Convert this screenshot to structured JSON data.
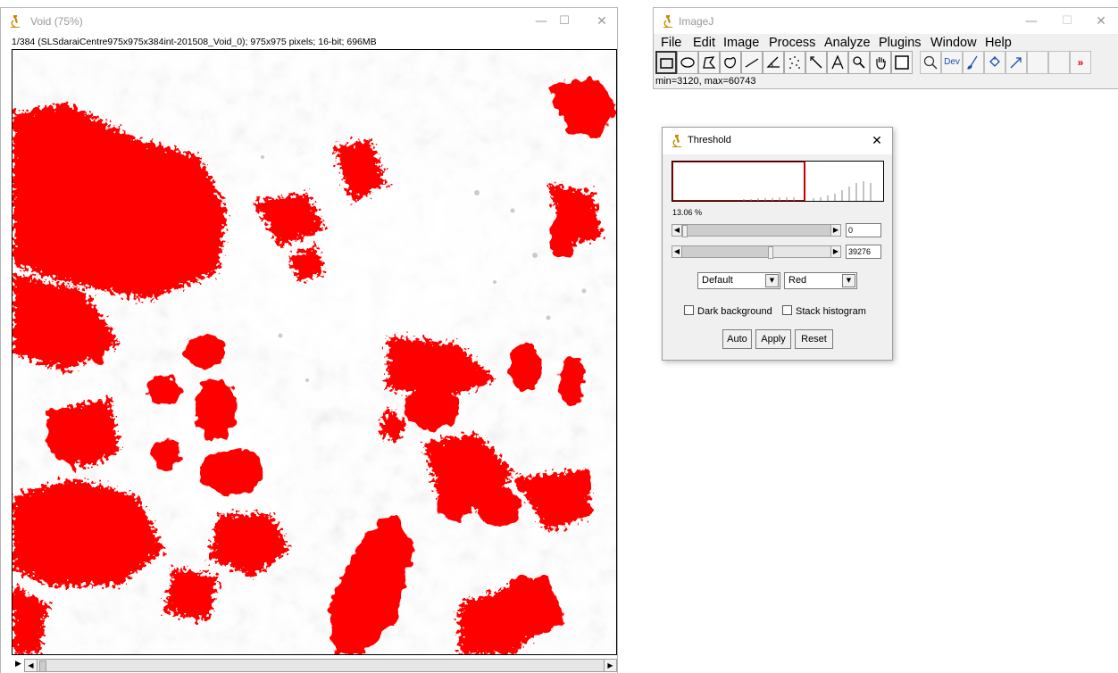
{
  "void_window": {
    "title": "Void (75%)",
    "info": "1/384 (SLSdaraiCentre975x975x384int-201508_Void_0); 975x975 pixels; 16-bit; 696MB",
    "slice_fraction": 0.0026
  },
  "imagej_window": {
    "title": "ImageJ",
    "menu": [
      "File",
      "Edit",
      "Image",
      "Process",
      "Analyze",
      "Plugins",
      "Window",
      "Help"
    ],
    "tools": [
      "rectangle-tool",
      "oval-tool",
      "polygon-tool",
      "freehand-tool",
      "line-tool",
      "angle-tool",
      "point-tool",
      "wand-tool",
      "text-tool",
      "magnifier-tool",
      "hand-tool",
      "color-picker-tool",
      "zoom-tool",
      "developer-menu",
      "brush-tool",
      "flood-fill-tool",
      "arrow-tool",
      "more-tools"
    ],
    "dev_label": "Dev",
    "more_label": "»",
    "status": "min=3120, max=60743"
  },
  "threshold_dialog": {
    "title": "Threshold",
    "percent": "13.06 %",
    "lower_value": "0",
    "upper_value": "39276",
    "lower_fraction": 0.0,
    "upper_fraction": 0.6,
    "method": "Default",
    "display": "Red",
    "dark_background_label": "Dark background",
    "stack_histogram_label": "Stack histogram",
    "auto_label": "Auto",
    "apply_label": "Apply",
    "reset_label": "Reset"
  },
  "colors": {
    "threshold_red": "#ff0000",
    "histogram_border": "#c00000",
    "window_bg": "#f0f0f0"
  },
  "window_controls": {
    "minimize": "—",
    "maximize": "☐",
    "close": "✕"
  }
}
